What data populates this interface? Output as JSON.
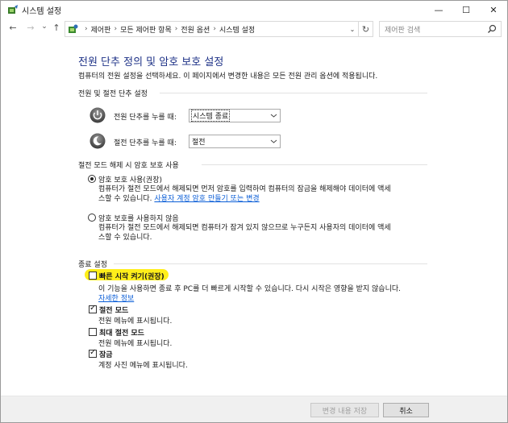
{
  "window": {
    "title": "시스템 설정",
    "minimize": "—",
    "maximize": "☐",
    "close": "✕"
  },
  "nav": {
    "back": "←",
    "forward": "→",
    "dropdown": "⌄",
    "up": "↑",
    "breadcrumbs": [
      "제어판",
      "모든 제어판 항목",
      "전원 옵션",
      "시스템 설정"
    ],
    "sep": "›",
    "refresh": "↻",
    "search_placeholder": "제어판 검색"
  },
  "main": {
    "heading": "전원 단추 정의 및 암호 보호 설정",
    "intro": "컴퓨터의 전원 설정을 선택하세요. 이 페이지에서 변경한 내용은 모든 전원 관리 옵션에 적용됩니다.",
    "buttons_section": {
      "title": "전원 및 절전 단추 설정",
      "power_label": "전원 단추를 누를 때:",
      "power_value": "시스템 종료",
      "sleep_label": "절전 단추를 누를 때:",
      "sleep_value": "절전"
    },
    "password_section": {
      "title": "절전 모드 해제 시 암호 보호 사용",
      "opt1_label": "암호 보호 사용(권장)",
      "opt1_desc1": "컴퓨터가 절전 모드에서 해제되면 먼저 암호를 입력하여 컴퓨터의 잠금을 해제해야 데이터에 액세",
      "opt1_desc2_prefix": "스할 수 있습니다. ",
      "opt1_link": "사용자 계정 암호 만들기 또는 변경",
      "opt2_label": "암호 보호를 사용하지 않음",
      "opt2_desc1": "컴퓨터가 절전 모드에서 해제되면 컴퓨터가 잠겨 있지 않으므로 누구든지 사용자의 데이터에 액세",
      "opt2_desc2": "스할 수 있습니다."
    },
    "shutdown_section": {
      "title": "종료 설정",
      "fast_startup_label": "빠른 시작 켜기(권장)",
      "fast_startup_desc": "이 기능을 사용하면 종료 후 PC를 더 빠르게 시작할 수 있습니다. 다시 시작은 영향을 받지 않습니다.",
      "fast_startup_link": "자세한 정보",
      "sleep_label": "절전 모드",
      "sleep_desc": "전원 메뉴에 표시됩니다.",
      "hibernate_label": "최대 절전 모드",
      "hibernate_desc": "전원 메뉴에 표시됩니다.",
      "lock_label": "잠금",
      "lock_desc": "계정 사진 메뉴에 표시됩니다."
    }
  },
  "footer": {
    "save_label": "변경 내용 저장",
    "cancel_label": "취소"
  },
  "state": {
    "password_option_selected": "opt1",
    "fast_startup_checked": false,
    "sleep_checked": true,
    "hibernate_checked": false,
    "lock_checked": true,
    "save_enabled": false
  },
  "colors": {
    "heading": "#1e3287",
    "link": "#0b5ed7",
    "highlight": "#ffee1a"
  }
}
